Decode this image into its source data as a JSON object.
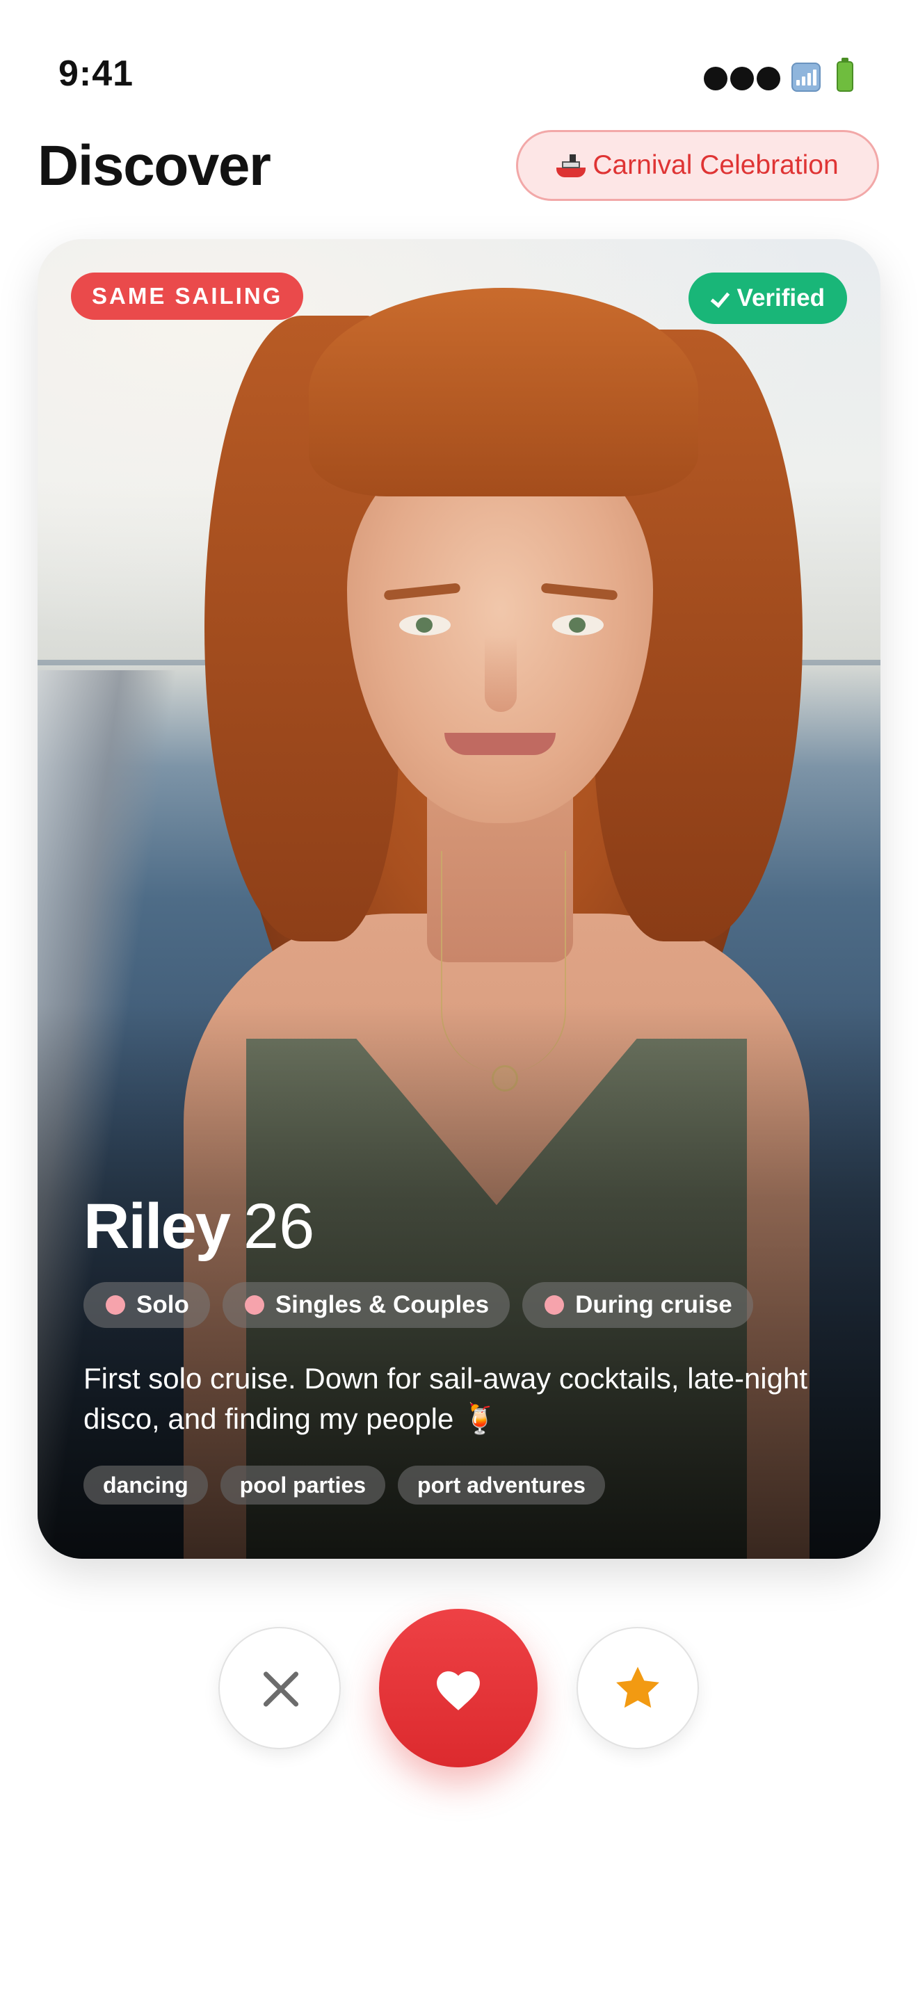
{
  "status_bar": {
    "time": "9:41",
    "icons": [
      "cellular-dots-icon",
      "signal-icon",
      "battery-icon"
    ]
  },
  "header": {
    "title": "Discover",
    "event_pill": {
      "icon": "ship-icon",
      "label": "Carnival Celebration",
      "color": "#df3434"
    }
  },
  "profile_card": {
    "badges": {
      "same_sailing": "SAME SAILING",
      "verified": "Verified",
      "same_sailing_color": "#ea4a4b",
      "verified_color": "#19b678"
    },
    "name": "Riley",
    "age": "26",
    "chips": [
      {
        "label": "Solo"
      },
      {
        "label": "Singles & Couples"
      },
      {
        "label": "During cruise"
      }
    ],
    "bio": "First solo cruise. Down for sail-away cocktails, late-night disco, and finding my people 🍹",
    "interests": [
      "dancing",
      "pool parties",
      "port adventures"
    ]
  },
  "actions": {
    "pass_icon": "close-icon",
    "like_icon": "heart-icon",
    "superlike_icon": "star-icon",
    "like_color": "#e33438",
    "superlike_color": "#f29a12"
  }
}
